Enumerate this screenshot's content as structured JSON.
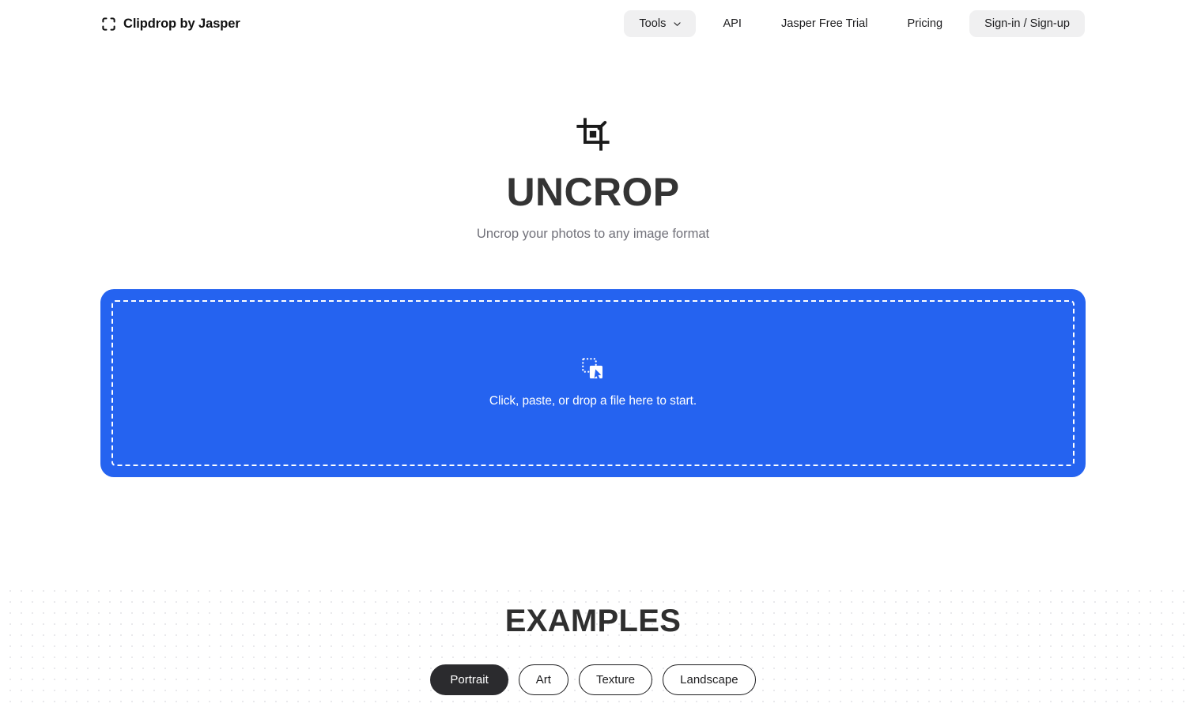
{
  "header": {
    "brand": {
      "icon": "crop-frame-logo-icon",
      "name": "Clipdrop",
      "suffix": " by Jasper"
    },
    "nav": [
      {
        "id": "tools",
        "label": "Tools",
        "icon": "chevron-down-icon",
        "style": "pill"
      },
      {
        "id": "api",
        "label": "API",
        "style": "plain"
      },
      {
        "id": "trial",
        "label": "Jasper Free Trial",
        "style": "plain"
      },
      {
        "id": "pricing",
        "label": "Pricing",
        "style": "plain"
      },
      {
        "id": "signin",
        "label": "Sign-in / Sign-up",
        "style": "pill"
      }
    ]
  },
  "hero": {
    "icon": "crop-tool-icon",
    "title": "UNCROP",
    "subtitle": "Uncrop your photos to any image format"
  },
  "dropzone": {
    "icon": "drop-file-cursor-icon",
    "label": "Click, paste, or drop a file here to start.",
    "accent_color": "#2563f0",
    "border_style": "dashed-white"
  },
  "examples": {
    "title": "EXAMPLES",
    "chips": [
      {
        "id": "portrait",
        "label": "Portrait",
        "active": true
      },
      {
        "id": "art",
        "label": "Art",
        "active": false
      },
      {
        "id": "texture",
        "label": "Texture",
        "active": false
      },
      {
        "id": "landscape",
        "label": "Landscape",
        "active": false
      }
    ]
  },
  "theme": {
    "accent": "#2563f0",
    "ink": "#2b2b2e",
    "muted": "#71717a",
    "pill_bg": "#f0f0f1",
    "page_bg": "#ffffff"
  }
}
